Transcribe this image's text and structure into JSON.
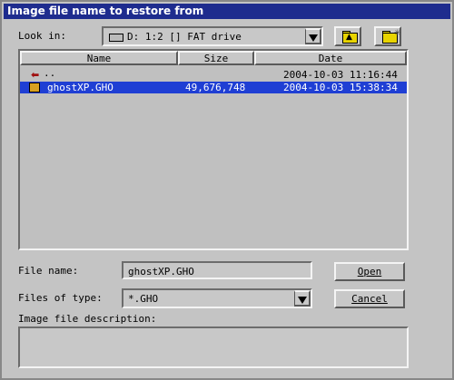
{
  "window": {
    "title": "Image file name to restore from"
  },
  "lookin": {
    "label": "Look in:",
    "value": "D: 1:2 [] FAT drive",
    "drive_icon": "drive-icon"
  },
  "toolbar": {
    "up_folder_icon": "folder-up-icon",
    "new_folder_icon": "new-folder-icon"
  },
  "filelist": {
    "columns": [
      "Name",
      "Size",
      "Date"
    ],
    "rows": [
      {
        "name": "..",
        "size": "",
        "date": "2004-10-03 11:16:44",
        "icon": "parent-folder-icon",
        "selected": false
      },
      {
        "name": "ghostXP.GHO",
        "size": "49,676,748",
        "date": "2004-10-03 15:38:34",
        "icon": "ghost-image-icon",
        "selected": true
      }
    ]
  },
  "filename": {
    "label": "File name:",
    "value": "ghostXP.GHO"
  },
  "filetype": {
    "label": "Files of type:",
    "value": "*.GHO"
  },
  "buttons": {
    "open": "Open",
    "cancel": "Cancel"
  },
  "description": {
    "label": "Image file description:",
    "value": ""
  }
}
